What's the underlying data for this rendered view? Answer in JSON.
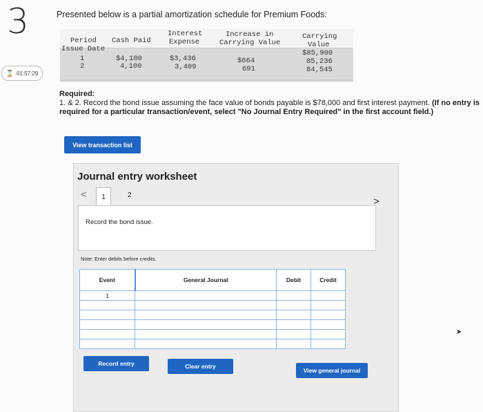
{
  "question_number": "3",
  "timer": "01:57:29",
  "intro": "Presented below is a partial amortization schedule for Premium Foods:",
  "schedule": {
    "headers": {
      "period": "Period",
      "issue_date": "Issue Date",
      "cash_paid": "Cash Paid",
      "interest_line1": "Interest",
      "interest_line2": "Expense",
      "increase_line1": "Increase in",
      "increase_line2": "Carrying Value",
      "carrying_line1": "Carrying",
      "carrying_line2": "Value"
    },
    "issue_carrying_value": "$85,900",
    "rows": [
      {
        "period": "1",
        "cash_paid": "$4,100",
        "interest": "$3,436",
        "increase": "$664",
        "carrying": "85,236"
      },
      {
        "period": "2",
        "cash_paid": "4,100",
        "interest": "3,409",
        "increase": "691",
        "carrying": "84,545"
      }
    ]
  },
  "required": {
    "heading": "Required:",
    "text": "1. & 2. Record the bond issue assuming the face value of bonds payable is $78,000 and first interest payment.",
    "bold_text": "(If no entry is required for a particular transaction/event, select \"No Journal Entry Required\" in the first account field.)"
  },
  "view_transaction_list": "View transaction list",
  "worksheet": {
    "title": "Journal entry worksheet",
    "tabs": [
      "1",
      "2"
    ],
    "description": "Record the bond issue.",
    "note": "Note: Enter debits before credits.",
    "columns": {
      "event": "Event",
      "general_journal": "General Journal",
      "debit": "Debit",
      "credit": "Credit"
    },
    "event_value": "1",
    "record_entry": "Record entry",
    "clear_entry": "Clear entry",
    "view_general_journal": "View general journal"
  }
}
